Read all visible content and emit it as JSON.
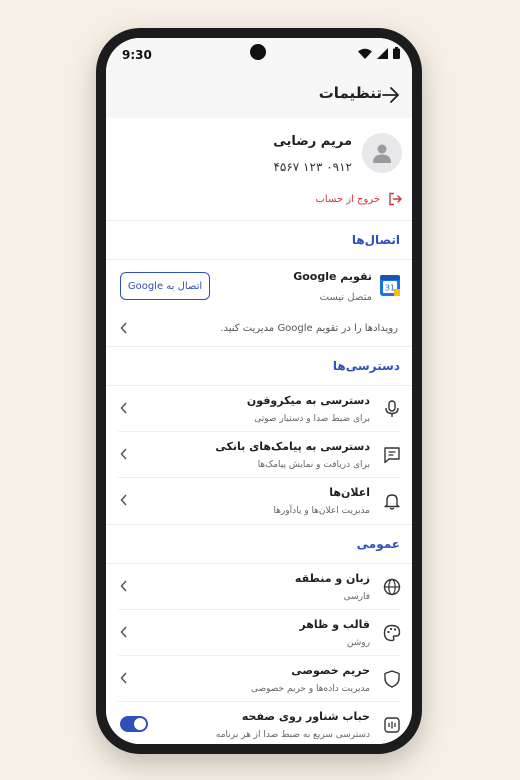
{
  "status_bar": {
    "time": "9:30"
  },
  "header": {
    "title": "تنظیمات"
  },
  "profile": {
    "name": "مریم رضایی",
    "phone": "۰۹۱۲ ۱۲۳ ۴۵۶۷",
    "logout_label": "خروج از حساب"
  },
  "connections": {
    "section_title": "اتصال‌ها",
    "google_calendar": {
      "title": "تقویم Google",
      "status": "متصل نیست",
      "connect_label": "اتصال به Google",
      "description": "رویدادها را در تقویم Google مدیریت کنید.",
      "icon_number": "31"
    }
  },
  "access": {
    "section_title": "دسترسی‌ها",
    "items": [
      {
        "title": "دسترسی به میکروفون",
        "subtitle": "برای ضبط صدا و دستیار صوتی"
      },
      {
        "title": "دسترسی به پیامک‌های بانکی",
        "subtitle": "برای دریافت و نمایش پیامک‌ها"
      },
      {
        "title": "اعلان‌ها",
        "subtitle": "مدیریت اعلان‌ها و یادآورها"
      }
    ]
  },
  "general": {
    "section_title": "عمومی",
    "items": [
      {
        "title": "زبان و منطقه",
        "subtitle": "فارسی"
      },
      {
        "title": "قالب و ظاهر",
        "subtitle": "روشن"
      },
      {
        "title": "حریم خصوصی",
        "subtitle": "مدیریت داده‌ها و حریم خصوصی"
      },
      {
        "title": "حباب شناور روی صفحه",
        "subtitle": "دسترسی سریع به ضبط صدا از هر برنامه",
        "toggle_on": true
      }
    ]
  },
  "colors": {
    "accent": "#2f50b8",
    "danger": "#d13438",
    "background": "#f6f0e6"
  }
}
